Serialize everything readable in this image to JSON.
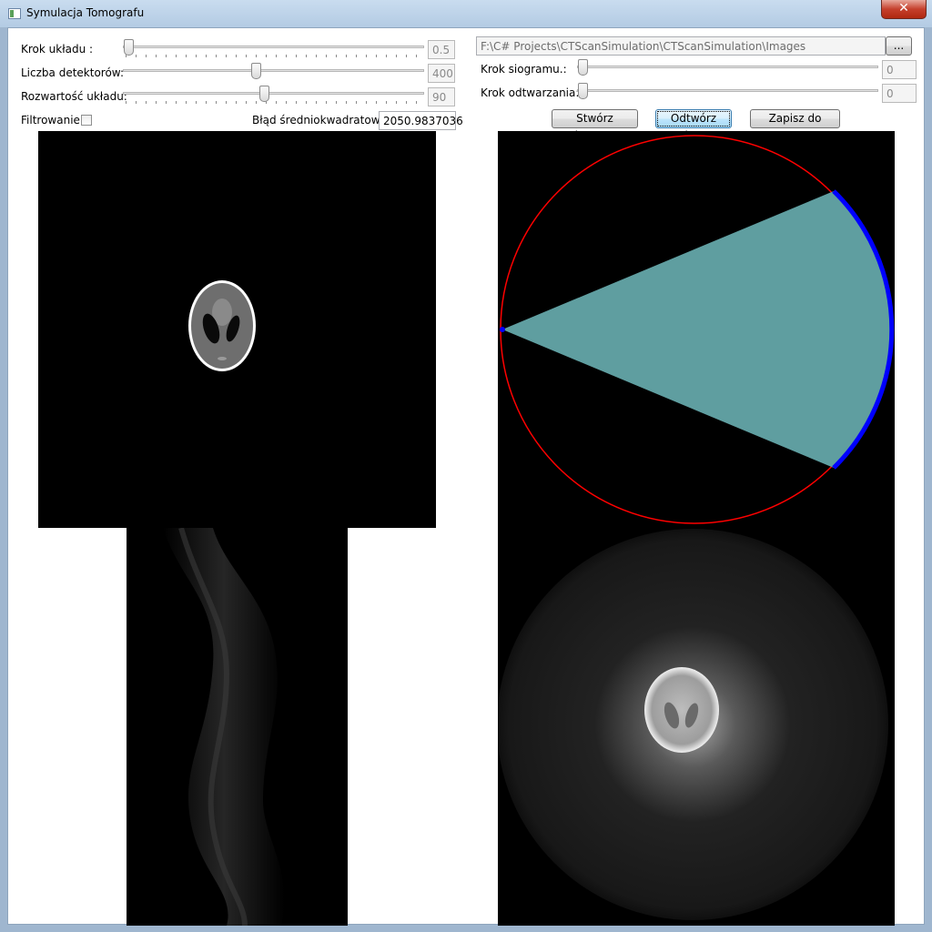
{
  "window": {
    "title": "Symulacja Tomografu",
    "close_glyph": "✕"
  },
  "left_controls": {
    "step": {
      "label": "Krok układu :",
      "value": "0.5",
      "level_fraction": 0.0
    },
    "detectors": {
      "label": "Liczba detektorów:",
      "value": "400",
      "level_fraction": 0.44
    },
    "spread": {
      "label": "Rozwartość układu:",
      "value": "90",
      "level_fraction": 0.46
    },
    "filtering": {
      "label": "Filtrowanie:",
      "checked": false
    },
    "mse": {
      "label": "Błąd średniokwadratowy:",
      "value": "2050.9837036"
    }
  },
  "right_controls": {
    "path": {
      "value": "F:\\C# Projects\\CTScanSimulation\\CTScanSimulation\\Images",
      "browse_label": "..."
    },
    "sinogram_step": {
      "label": "Krok siogramu.:",
      "value": "0",
      "level_fraction": 0.0
    },
    "reconstruct_step": {
      "label": "Krok odtwarzania:",
      "value": "0",
      "level_fraction": 0.0
    },
    "buttons": {
      "create_sinogram": "Stwórz sinogram",
      "reconstruct": "Odtwórz obraz",
      "save_dicom": "Zapisz do DICOM"
    }
  },
  "colors": {
    "scan_circle": "#ff0000",
    "detector_arc": "#0000ff",
    "ray_fan": "#5f9ea0",
    "window_frame": "#9fb6cf"
  },
  "icons": [
    "app-icon",
    "close-icon",
    "checkbox"
  ]
}
